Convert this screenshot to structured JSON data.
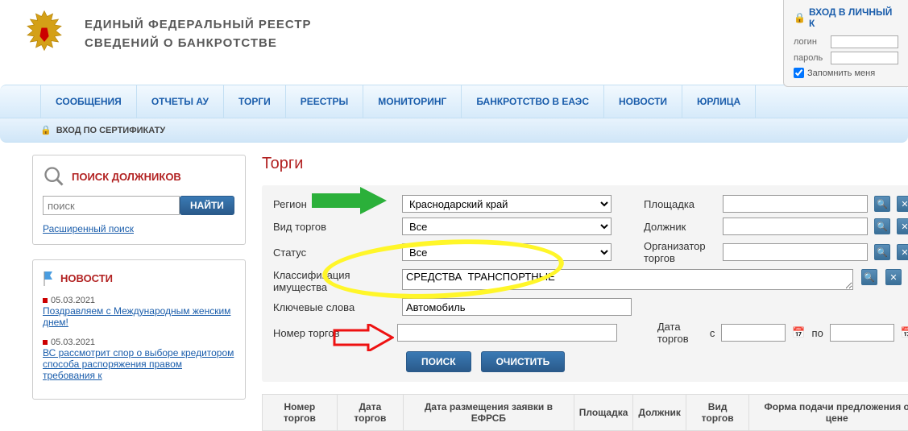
{
  "header": {
    "title_line1": "ЕДИНЫЙ  ФЕДЕРАЛЬНЫЙ  РЕЕСТР",
    "title_line2": "СВЕДЕНИЙ О БАНКРОТСТВЕ"
  },
  "login": {
    "title": "ВХОД В ЛИЧНЫЙ К",
    "login_label": "логин",
    "password_label": "пароль",
    "remember_label": "Запомнить меня"
  },
  "nav": {
    "items": [
      "СООБЩЕНИЯ",
      "ОТЧЕТЫ АУ",
      "ТОРГИ",
      "РЕЕСТРЫ",
      "МОНИТОРИНГ",
      "БАНКРОТСТВО В ЕАЭС",
      "НОВОСТИ",
      "ЮРЛИЦА"
    ]
  },
  "cert_login": "ВХОД ПО СЕРТИФИКАТУ",
  "sidebar": {
    "search_title": "ПОИСК ДОЛЖНИКОВ",
    "search_placeholder": "поиск",
    "find_btn": "НАЙТИ",
    "ext_search": "Расширенный поиск",
    "news_title": "НОВОСТИ",
    "news": [
      {
        "date": "05.03.2021",
        "text": "Поздравляем с Международным женским днем!"
      },
      {
        "date": "05.03.2021",
        "text": "ВС рассмотрит спор о выборе кредитором способа распоряжения правом требования к"
      }
    ]
  },
  "main": {
    "title": "Торги",
    "labels": {
      "region": "Регион",
      "type": "Вид торгов",
      "status": "Статус",
      "classification": "Классификация имущества",
      "keywords": "Ключевые слова",
      "number": "Номер торгов",
      "platform": "Площадка",
      "debtor": "Должник",
      "organizer": "Организатор торгов",
      "date": "Дата торгов",
      "date_from": "с",
      "date_to": "по"
    },
    "values": {
      "region": "Краснодарский край",
      "type": "Все",
      "status": "Все",
      "classification": "СРЕДСТВА  ТРАНСПОРТНЫЕ",
      "keywords": "Автомобиль"
    },
    "btn_search": "ПОИСК",
    "btn_clear": "ОЧИСТИТЬ"
  },
  "table": {
    "headers": [
      "Номер торгов",
      "Дата торгов",
      "Дата размещения заявки в ЕФРСБ",
      "Площадка",
      "Должник",
      "Вид торгов",
      "Форма подачи предложения о цене"
    ]
  }
}
